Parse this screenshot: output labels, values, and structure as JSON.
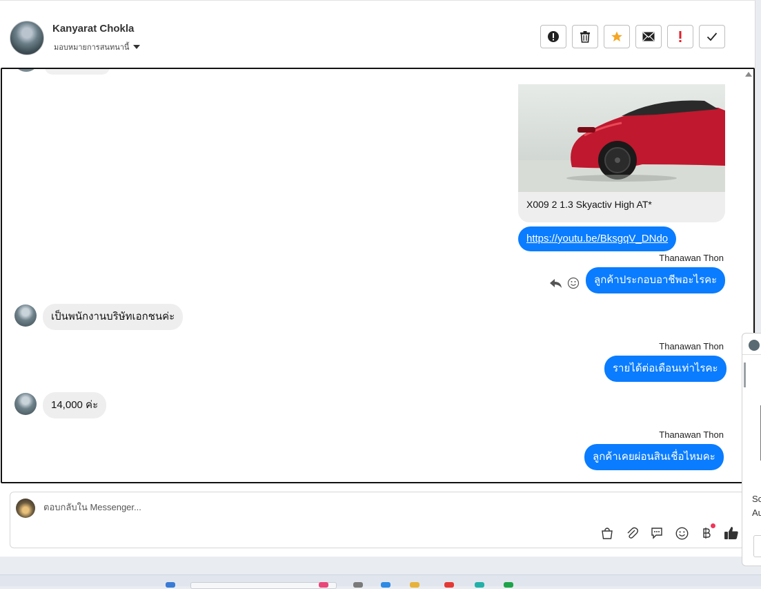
{
  "header": {
    "contact_name": "Kanyarat Chokla",
    "assign_label": "มอบหมายการสนทนานี้",
    "actions": [
      {
        "name": "report-icon",
        "label": "!"
      },
      {
        "name": "trash-icon",
        "label": "delete"
      },
      {
        "name": "star-icon",
        "label": "star"
      },
      {
        "name": "mail-icon",
        "label": "mail"
      },
      {
        "name": "important-icon",
        "label": "!"
      },
      {
        "name": "check-icon",
        "label": "done"
      }
    ]
  },
  "messages": {
    "card_title": "X009 2 1.3 Skyactiv High AT*",
    "link_text": "https://youtu.be/BksgqV_DNdo",
    "sender": "Thanawan Thon",
    "out_1": "ลูกค้าประกอบอาชีพอะไรคะ",
    "in_1": "เป็นพนักงานบริษัทเอกชนค่ะ",
    "out_2": "รายได้ต่อเดือนเท่าไรคะ",
    "in_2": "14,000 ค่ะ",
    "out_3": "ลูกค้าเคยผ่อนสินเชื่อไหมคะ"
  },
  "composer": {
    "placeholder": "ตอบกลับใน Messenger...",
    "tools": [
      "bag-icon",
      "attach-icon",
      "chat-bubble-icon",
      "emoji-icon",
      "baht-icon",
      "thumbs-up-icon"
    ]
  },
  "side_panel": {
    "text_1": "Sc",
    "text_2": "Au"
  },
  "colors": {
    "accent": "#0a7cff",
    "star": "#f5a623",
    "important": "#e0202a"
  }
}
